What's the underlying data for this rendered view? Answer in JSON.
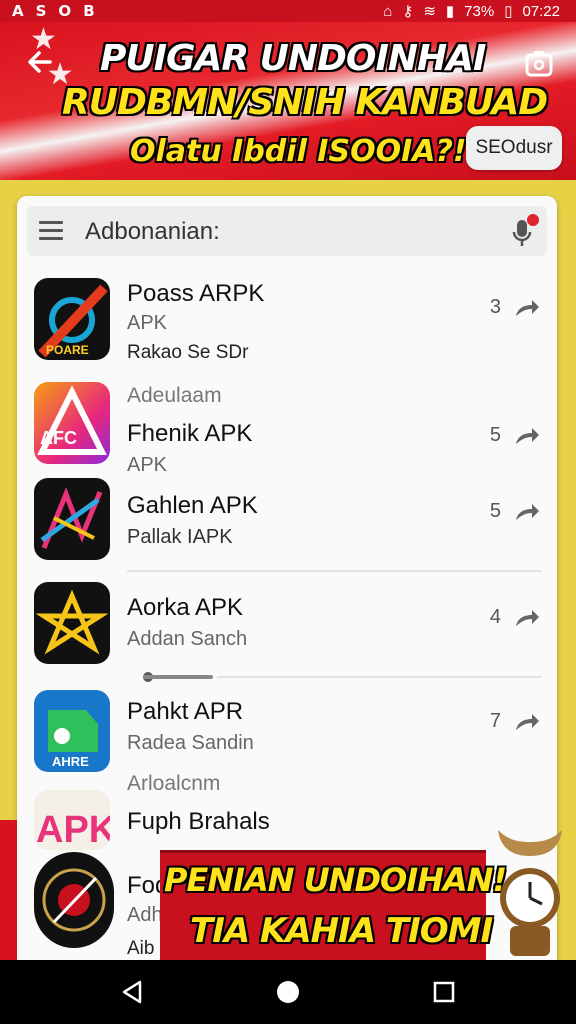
{
  "status_bar": {
    "left_icons": [
      "a-icon",
      "s-icon",
      "o-icon",
      "b-icon"
    ],
    "battery": "73%",
    "time": "07:22"
  },
  "hero": {
    "title": "PUIGAR UNDOINHAI",
    "subtitle": "RUDBMN/SNIH KANBUAD",
    "tagline": "Olatu Ibdil ISOOIA?!",
    "chip_label": "SEOdusr"
  },
  "search": {
    "placeholder": "Adbonanian:"
  },
  "apps": [
    {
      "name": "Poass ARPK",
      "sub": "APK",
      "sub2": "Rakao Se SDr",
      "count": "3",
      "icon_label": "POARE"
    },
    {
      "section": "Adeulaam",
      "name": "Fhenik APK",
      "sub": "APK",
      "count": "5",
      "icon_label": "AFC"
    },
    {
      "name": "Gahlen APK",
      "sub": "Pallak IAPK",
      "count": "5",
      "icon_label": ""
    },
    {
      "name": "Aorka APK",
      "sub": "Addan Sanch",
      "count": "4",
      "icon_label": ""
    },
    {
      "name": "Pahkt APR",
      "sub": "Radea Sandin",
      "count": "7",
      "icon_label": "AHRE"
    },
    {
      "section": "Arloalcnm",
      "name": "Fuph Brahals",
      "icon_label": "APK"
    },
    {
      "name": "Foq",
      "sub": "Adh",
      "sub2": "Aib"
    }
  ],
  "promo_banner": {
    "line1": "PENIAN UNDOIHAN!",
    "line2": "TIA KAHIA TIOMI"
  },
  "nav": {
    "back": "back-icon",
    "home": "home-icon",
    "recents": "recents-icon"
  },
  "colors": {
    "accent_red": "#c8101e",
    "accent_yellow": "#ffe21a",
    "frame": "#e7d246"
  }
}
